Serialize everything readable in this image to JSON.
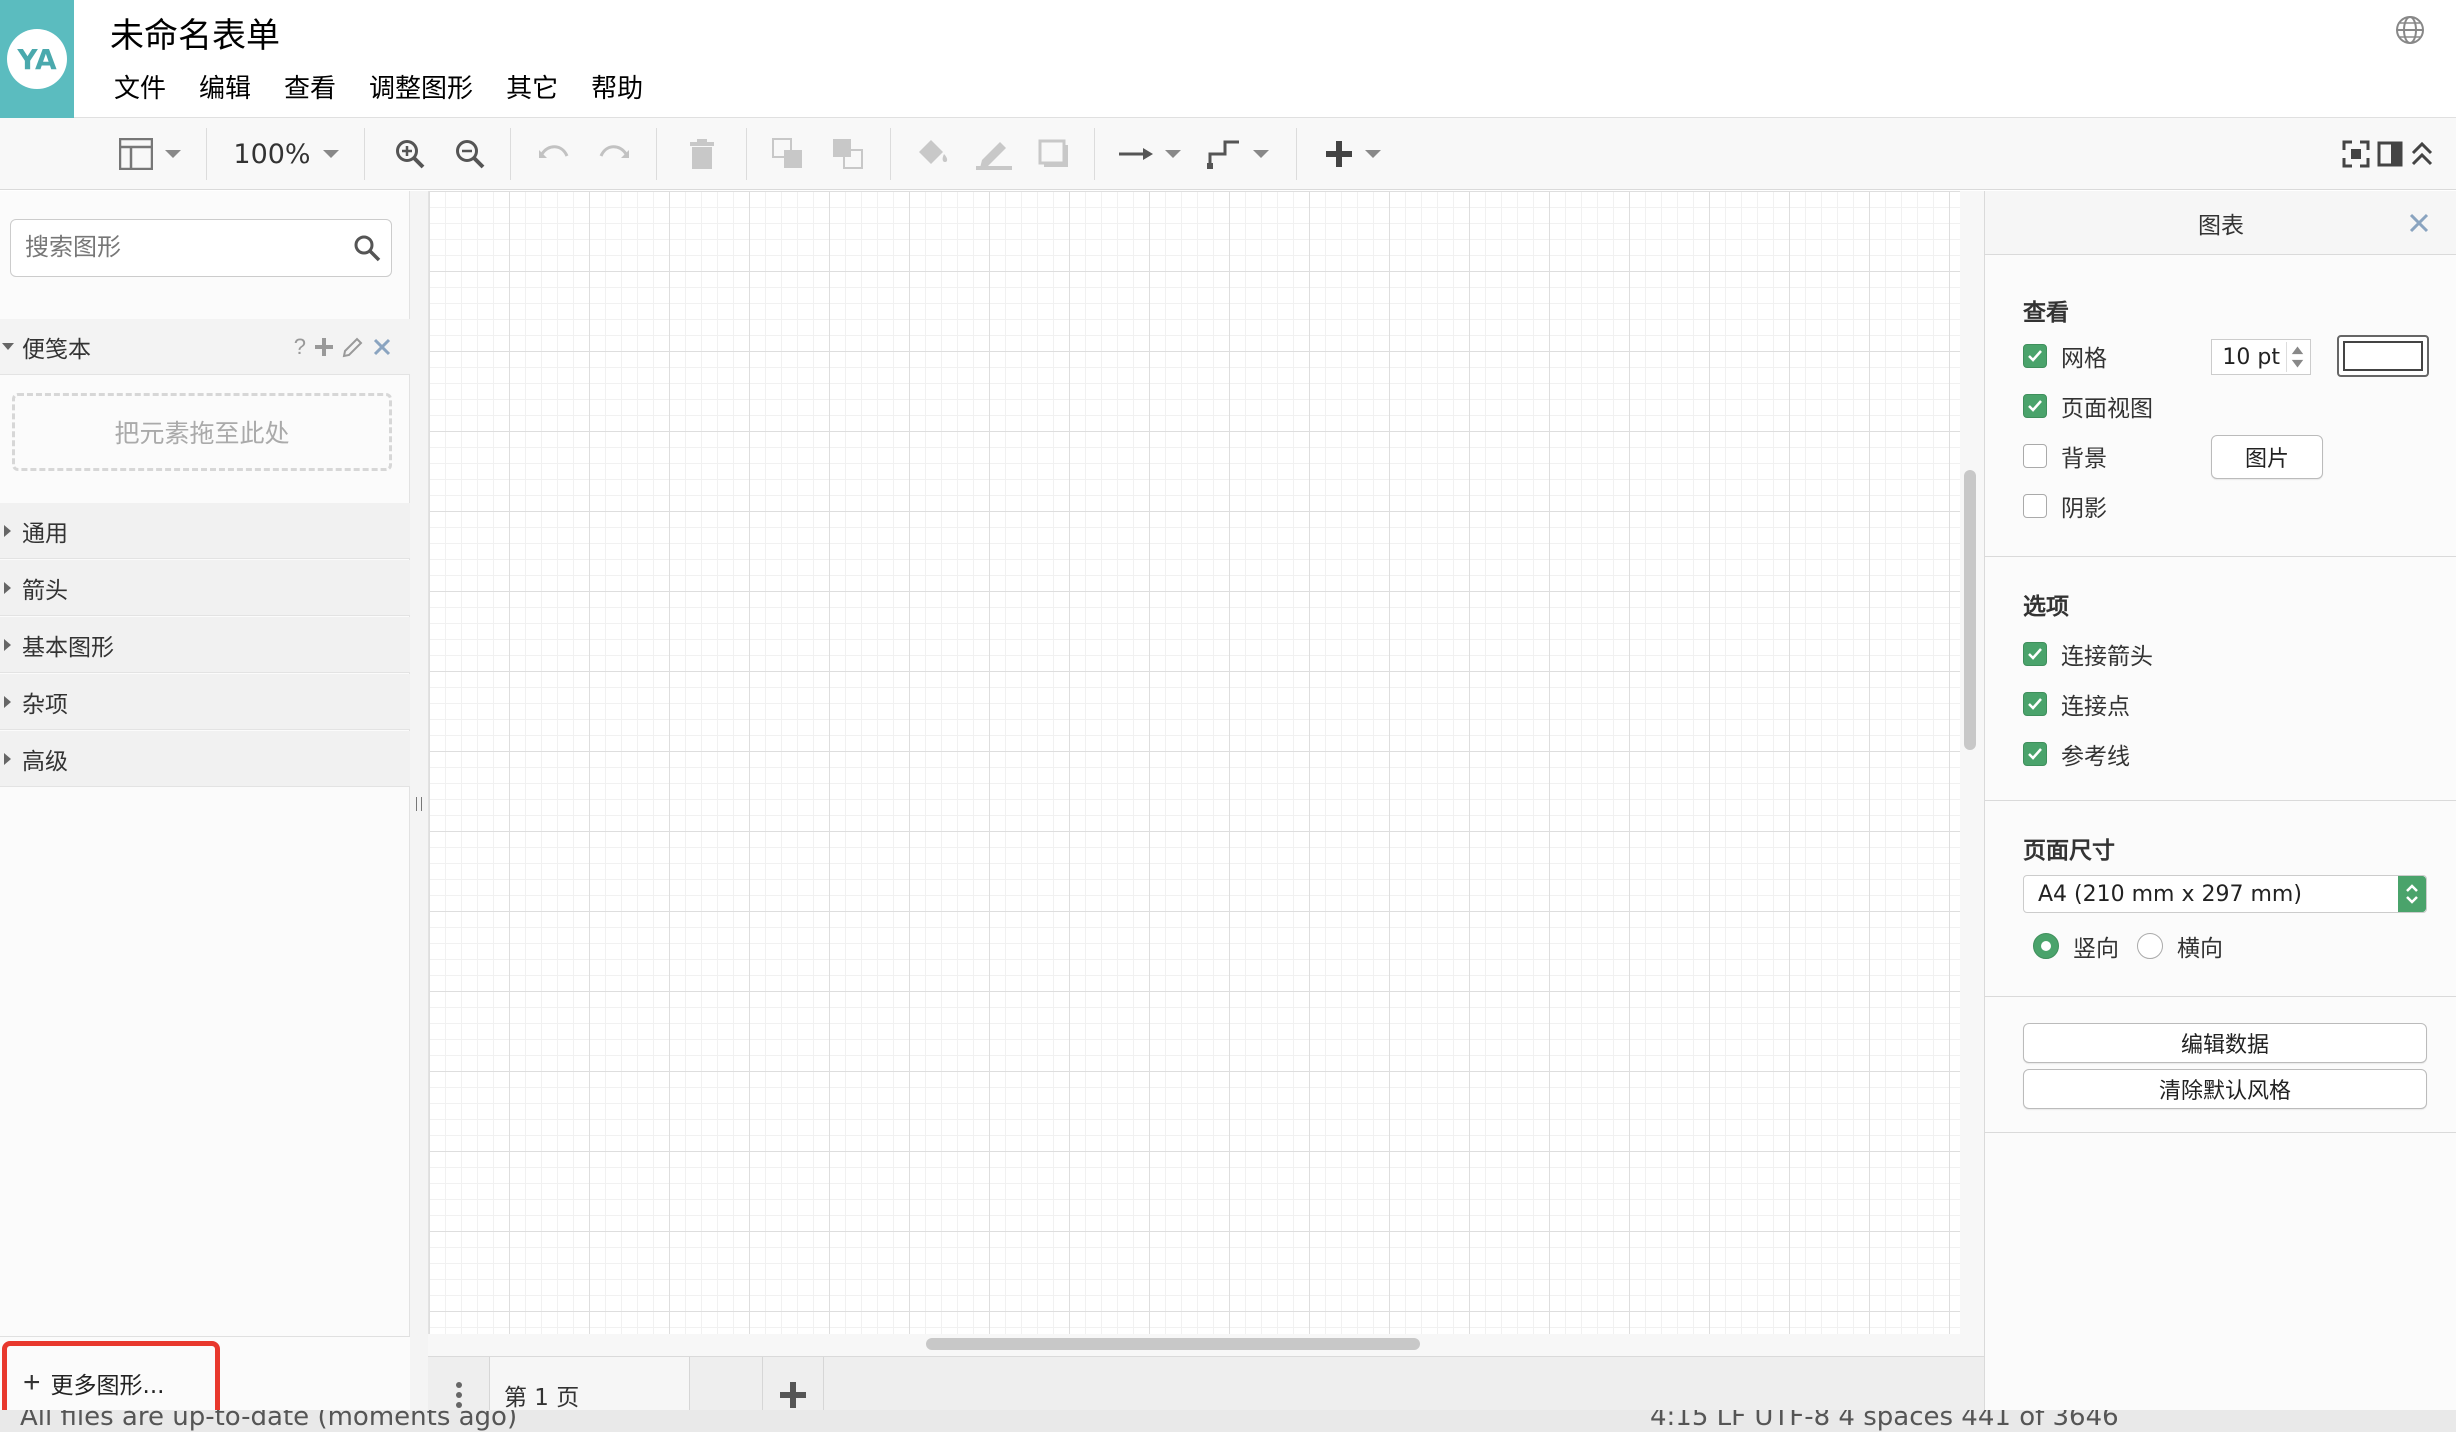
{
  "app": {
    "logo_text": "YA",
    "title": "未命名表单"
  },
  "menu": [
    "文件",
    "编辑",
    "查看",
    "调整图形",
    "其它",
    "帮助"
  ],
  "toolbar": {
    "zoom": "100%"
  },
  "sidebar": {
    "search_placeholder": "搜索图形",
    "scratchpad": {
      "label": "便笺本",
      "help": "?",
      "dropzone": "把元素拖至此处"
    },
    "sections": [
      "通用",
      "箭头",
      "基本图形",
      "杂项",
      "高级"
    ],
    "more_shapes": "更多图形..."
  },
  "pages": {
    "current": "第 1 页"
  },
  "format_panel": {
    "title": "图表",
    "view": {
      "title": "查看",
      "grid": {
        "label": "网格",
        "checked": true,
        "size": "10 pt"
      },
      "page_view": {
        "label": "页面视图",
        "checked": true
      },
      "background": {
        "label": "背景",
        "checked": false,
        "button": "图片"
      },
      "shadow": {
        "label": "阴影",
        "checked": false
      }
    },
    "options": {
      "title": "选项",
      "connection_arrows": {
        "label": "连接箭头",
        "checked": true
      },
      "connection_points": {
        "label": "连接点",
        "checked": true
      },
      "guides": {
        "label": "参考线",
        "checked": true
      }
    },
    "paper_size": {
      "title": "页面尺寸",
      "selected": "A4 (210 mm x 297 mm)",
      "portrait": "竖向",
      "landscape": "横向",
      "orientation": "portrait"
    },
    "buttons": {
      "edit_data": "编辑数据",
      "clear_default_style": "清除默认风格"
    }
  },
  "status": {
    "left": "All files are up-to-date (moments ago)",
    "right": "4:15   LF   UTF-8   4 spaces   441 of 3646"
  },
  "colors": {
    "accent": "#4aa36b",
    "logo_bg": "#5bbcbf",
    "highlight": "#e8382d"
  }
}
